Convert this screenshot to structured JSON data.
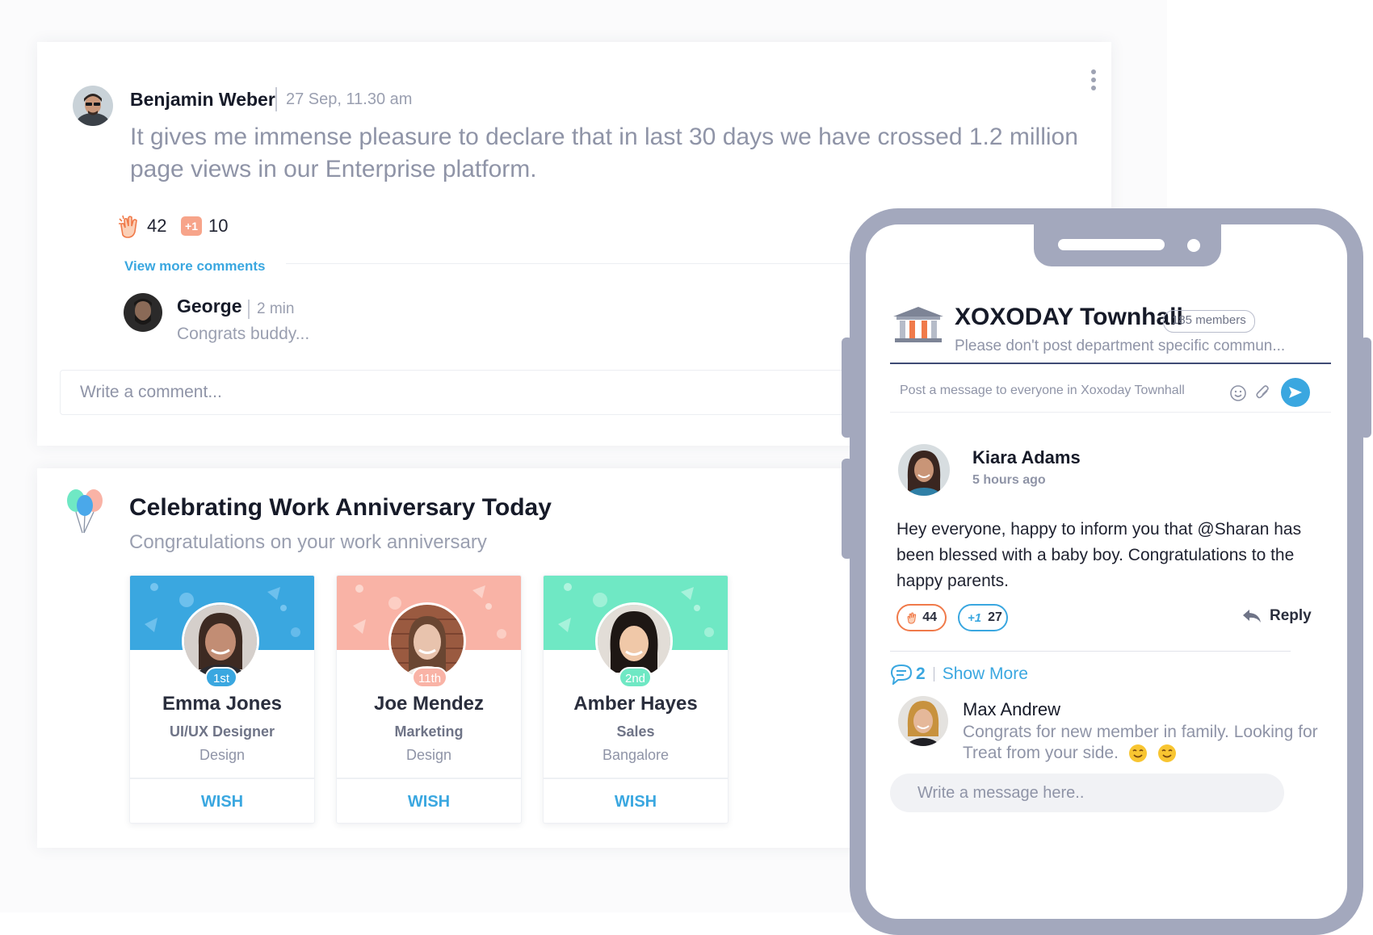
{
  "post": {
    "author": "Benjamin Weber",
    "time": "27 Sep, 11.30 am",
    "text": "It gives me immense pleasure to declare that in last 30 days we have crossed 1.2 million page views in our Enterprise platform.",
    "clap_count": "42",
    "plus_one_label": "+1",
    "plus_one_count": "10",
    "view_more": "View more comments",
    "comment": {
      "author": "George",
      "time": "2 min",
      "text": "Congrats buddy..."
    },
    "comment_placeholder": "Write a comment..."
  },
  "anniversary": {
    "title": "Celebrating Work Anniversary Today",
    "subtitle": "Congratulations on your work anniversary",
    "people": [
      {
        "name": "Emma Jones",
        "role": "UI/UX Designer",
        "dept": "Design",
        "rank": "1st",
        "wish": "WISH"
      },
      {
        "name": "Joe Mendez",
        "role": "Marketing",
        "dept": "Design",
        "rank": "11th",
        "wish": "WISH"
      },
      {
        "name": "Amber Hayes",
        "role": "Sales",
        "dept": "Bangalore",
        "rank": "2nd",
        "wish": "WISH"
      }
    ]
  },
  "phone": {
    "group_title": "XOXODAY Townhall",
    "members": "185 members",
    "group_desc": "Please don't post department specific commun...",
    "post_placeholder": "Post a message to everyone in Xoxoday Townhall",
    "message": {
      "author": "Kiara Adams",
      "time": "5 hours ago",
      "text": "Hey everyone, happy to inform you that @Sharan has been blessed with a baby boy. Congratulations to the happy parents.",
      "clap_count": "44",
      "plus_one_count": "27",
      "reply": "Reply"
    },
    "comments_count": "2",
    "show_more": "Show More",
    "reply_comment": {
      "author": "Max Andrew",
      "text": "Congrats for new member in family. Looking for Treat from your side."
    },
    "message_placeholder": "Write a message here.."
  },
  "icons": [
    "more-vertical-icon",
    "clap-icon",
    "plus-one-icon",
    "balloon-icon",
    "bank-icon",
    "emoji-icon",
    "attachment-icon",
    "send-icon",
    "reply-arrow-icon",
    "comment-bubble-icon",
    "smile-emoji-icon"
  ],
  "colors": {
    "accent_blue": "#3aa7e0",
    "phone_frame": "#a3a8bd",
    "banner_blue": "#3aa7e0",
    "banner_peach": "#f9b3a6",
    "banner_mint": "#6fe8c4",
    "clap_orange": "#f07a4a"
  }
}
